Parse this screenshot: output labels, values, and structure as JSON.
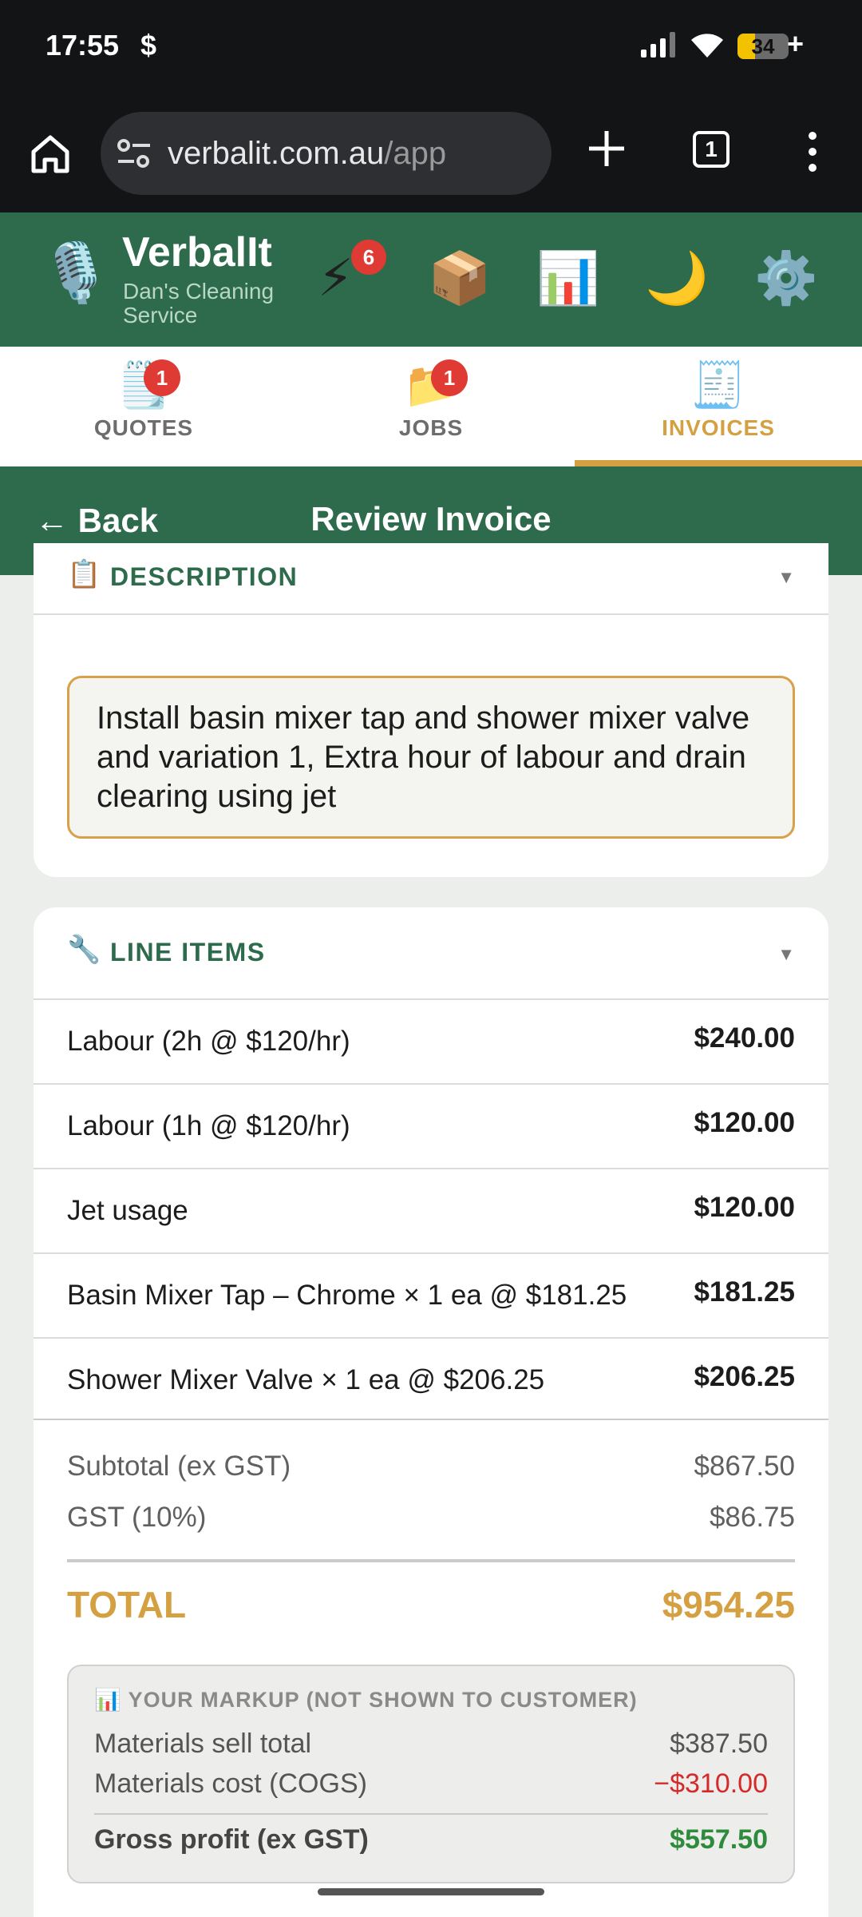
{
  "status_bar": {
    "time": "17:55",
    "extra_icon": "$",
    "battery": "34",
    "battery_level": 0.34,
    "charging": "+"
  },
  "browser": {
    "url_host": "verbalit.com.au",
    "url_path": "/app",
    "tab_count": "1"
  },
  "app_header": {
    "brand": "VerbalIt",
    "business": "Dan's Cleaning Service",
    "lightning_badge": "6",
    "icons": [
      "microphone-icon",
      "lightning-icon",
      "package-icon",
      "bar-chart-icon",
      "moon-icon",
      "gear-icon"
    ]
  },
  "tabs": [
    {
      "label": "QUOTES",
      "badge": "1",
      "active": false
    },
    {
      "label": "JOBS",
      "badge": "1",
      "active": false
    },
    {
      "label": "INVOICES",
      "badge": "",
      "active": true
    }
  ],
  "title_bar": {
    "back": "← Back",
    "title": "Review Invoice"
  },
  "description": {
    "heading": "DESCRIPTION",
    "text": "Install basin mixer tap and shower mixer valve and variation 1, Extra hour of labour and drain clearing using jet"
  },
  "line_items": {
    "heading": "LINE ITEMS",
    "items": [
      {
        "description": "Labour (2h @ $120/hr)",
        "amount": "$240.00"
      },
      {
        "description": "Labour (1h @ $120/hr)",
        "amount": "$120.00"
      },
      {
        "description": "Jet usage",
        "amount": "$120.00"
      },
      {
        "description": "Basin Mixer Tap – Chrome × 1 ea @ $181.25",
        "amount": "$181.25"
      },
      {
        "description": "Shower Mixer Valve × 1 ea @ $206.25",
        "amount": "$206.25"
      }
    ]
  },
  "totals": {
    "subtotal_label": "Subtotal (ex GST)",
    "subtotal": "$867.50",
    "gst_label": "GST (10%)",
    "gst": "$86.75",
    "total_label": "TOTAL",
    "total": "$954.25"
  },
  "markup": {
    "heading": "YOUR MARKUP (NOT SHOWN TO CUSTOMER)",
    "sell_label": "Materials sell total",
    "sell": "$387.50",
    "cost_label": "Materials cost (COGS)",
    "cost": "−$310.00",
    "profit_label": "Gross profit (ex GST)",
    "profit": "$557.50"
  },
  "colors": {
    "brand_green": "#2e6b4c",
    "accent_gold": "#d4a042",
    "badge_red": "#e03a34",
    "negative_red": "#d42a2a",
    "positive_green": "#2e8b3c"
  }
}
